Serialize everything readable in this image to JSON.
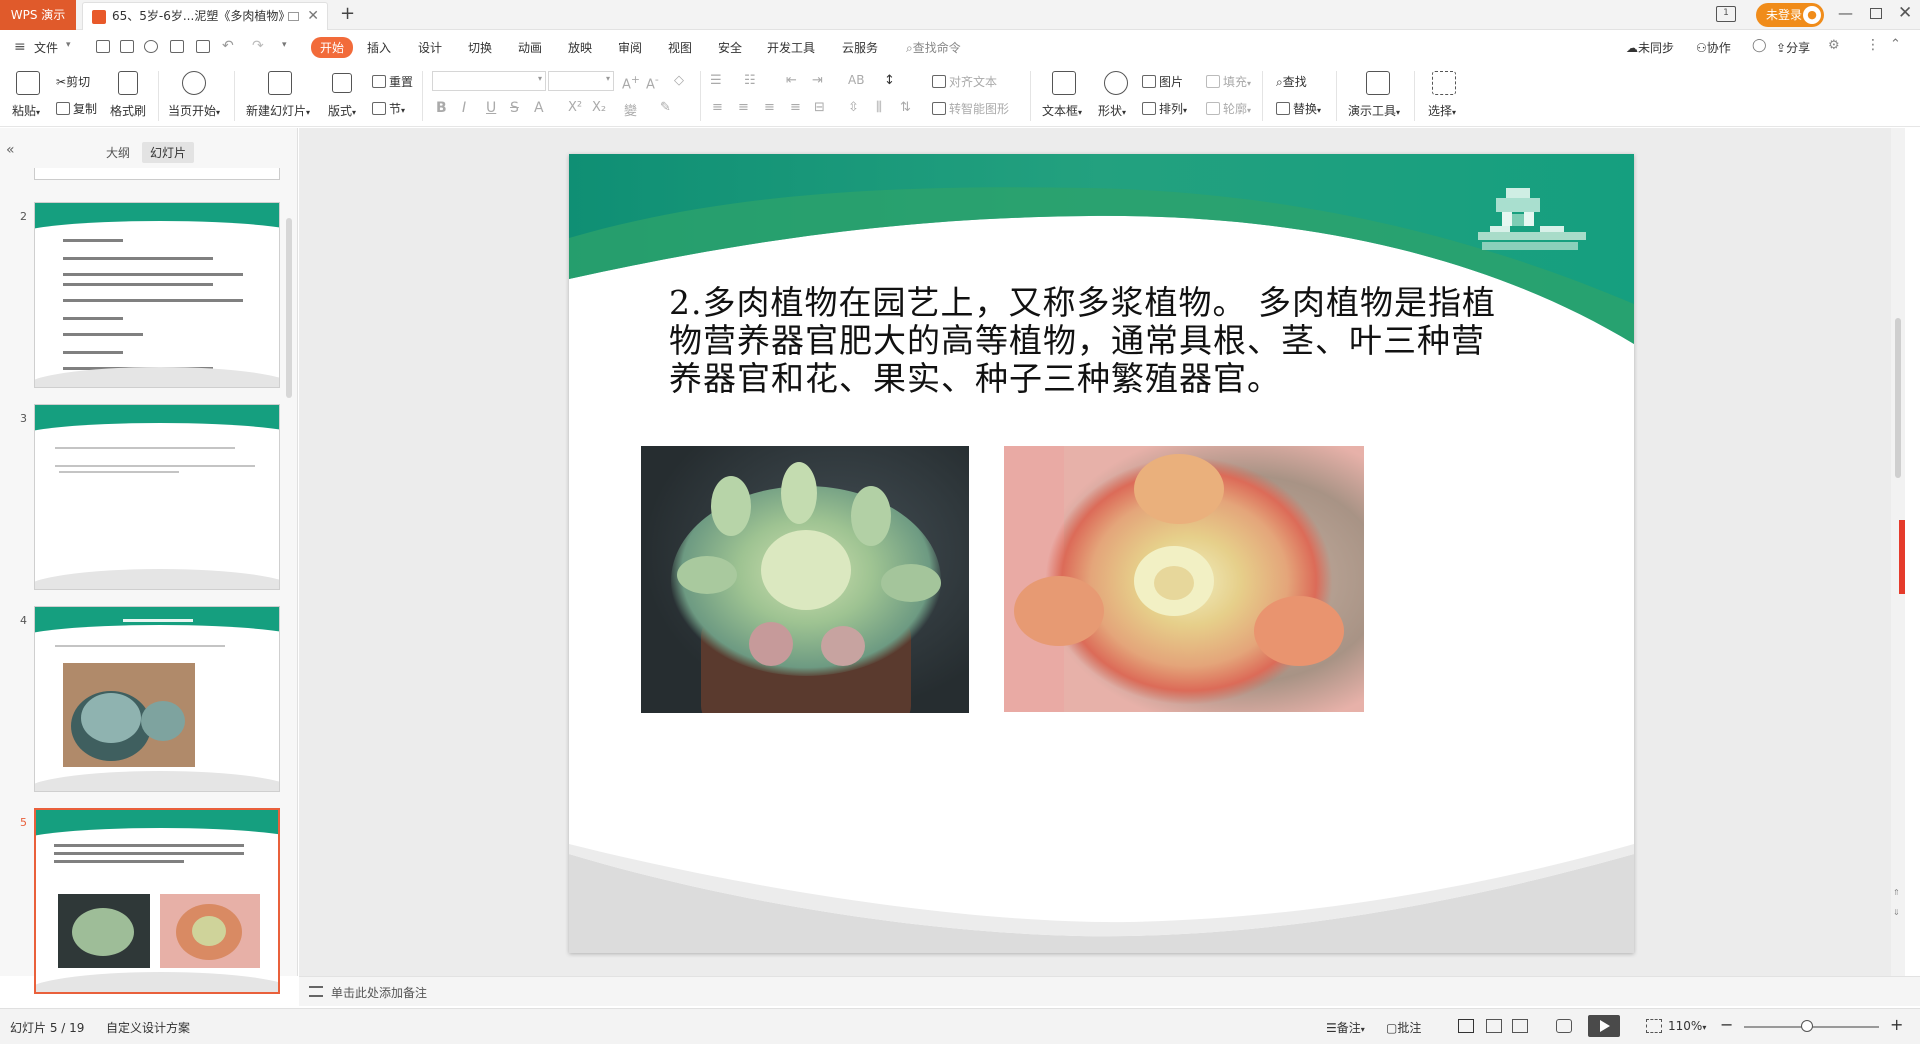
{
  "titlebar": {
    "app_name": "WPS 演示",
    "doc_title": "65、5岁-6岁...泥塑《多肉植物》",
    "login": "未登录"
  },
  "menu": {
    "file": "文件",
    "tabs": [
      "开始",
      "插入",
      "设计",
      "切换",
      "动画",
      "放映",
      "审阅",
      "视图",
      "安全",
      "开发工具",
      "云服务"
    ],
    "active_tab": "开始",
    "search_placeholder": "查找命令",
    "right": [
      "未同步",
      "协作",
      "分享"
    ]
  },
  "ribbon": {
    "paste": "粘贴",
    "cut": "剪切",
    "copy": "复制",
    "format_painter": "格式刷",
    "from_current": "当页开始",
    "new_slide": "新建幻灯片",
    "layout": "版式",
    "section": "节",
    "reset": "重置",
    "align_text": "对齐文本",
    "smart_graphic": "转智能图形",
    "textbox": "文本框",
    "shape": "形状",
    "picture": "图片",
    "arrange": "排列",
    "fill": "填充",
    "outline": "轮廓",
    "find": "查找",
    "replace": "替换",
    "presenter_tools": "演示工具",
    "select": "选择"
  },
  "left_pane": {
    "tab_outline": "大纲",
    "tab_slides": "幻灯片",
    "active_tab": "幻灯片",
    "thumbnails": [
      {
        "num": "2",
        "selected": false
      },
      {
        "num": "3",
        "selected": false
      },
      {
        "num": "4",
        "selected": false
      },
      {
        "num": "5",
        "selected": true
      }
    ]
  },
  "slide": {
    "text": "2.多肉植物在园艺上，又称多浆植物。 多肉植物是指植物营养器官肥大的高等植物，通常具根、茎、叶三种营养器官和花、果实、种子三种繁殖器官。",
    "colors": {
      "header_green": "#159f7f",
      "footer_gray": "#dedede"
    },
    "images": [
      "succulent-cluster-photo",
      "succulent-rosette-photo"
    ]
  },
  "notes_placeholder": "单击此处添加备注",
  "statusbar": {
    "slide_counter": "幻灯片 5 / 19",
    "design": "自定义设计方案",
    "notes": "备注",
    "comments": "批注",
    "zoom": "110%",
    "zoom_fraction": 0.47
  }
}
